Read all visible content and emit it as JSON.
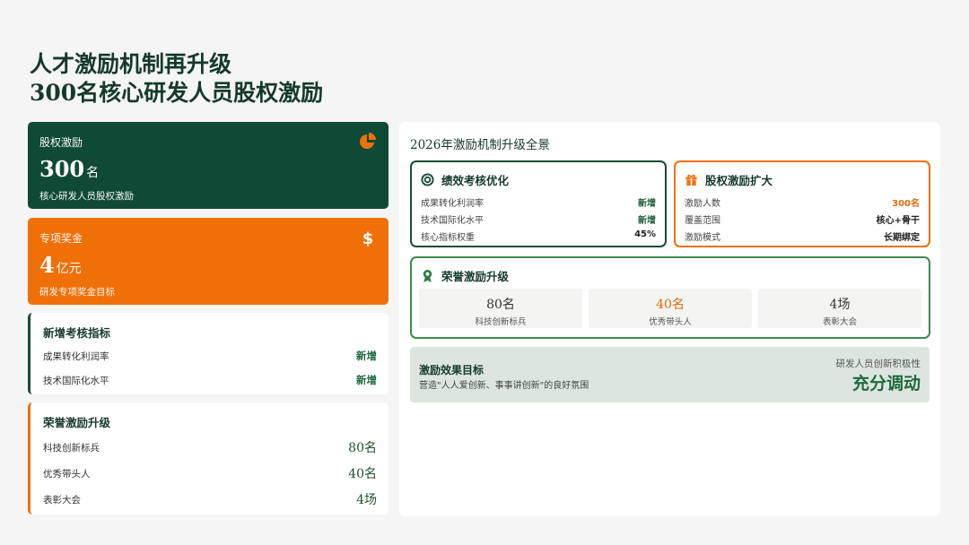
{
  "title": {
    "line1": "人才激励机制再升级",
    "line2": "300名核心研发人员股权激励"
  },
  "left": {
    "equity_card": {
      "label": "股权激励",
      "value": "300",
      "unit": "名",
      "sub": "核心研发人员股权激励",
      "icon": "pie-chart-icon",
      "bg": "#0f4a37"
    },
    "bonus_card": {
      "label": "专项奖金",
      "value": "4",
      "unit": "亿元",
      "sub": "研发专项奖金目标",
      "icon": "dollar-icon",
      "bg": "#f07008"
    },
    "new_metrics": {
      "heading": "新增考核指标",
      "rows": [
        {
          "label": "成果转化利润率",
          "value": "新增"
        },
        {
          "label": "技术国际化水平",
          "value": "新增"
        }
      ]
    },
    "honor": {
      "heading": "荣誉激励升级",
      "rows": [
        {
          "label": "科技创新标兵",
          "value": "80名"
        },
        {
          "label": "优秀带头人",
          "value": "40名"
        },
        {
          "label": "表彰大会",
          "value": "4场"
        }
      ]
    }
  },
  "panel": {
    "title": "2026年激励机制升级全景",
    "perf": {
      "heading": "绩效考核优化",
      "icon": "target-icon",
      "rows": [
        {
          "label": "成果转化利润率",
          "value": "新增"
        },
        {
          "label": "技术国际化水平",
          "value": "新增"
        },
        {
          "label": "核心指标权重",
          "value": "45%"
        }
      ]
    },
    "equity": {
      "heading": "股权激励扩大",
      "icon": "gift-icon",
      "rows": [
        {
          "label": "激励人数",
          "value": "300名"
        },
        {
          "label": "覆盖范围",
          "value": "核心+骨干"
        },
        {
          "label": "激励模式",
          "value": "长期绑定"
        }
      ]
    },
    "honor": {
      "heading": "荣誉激励升级",
      "icon": "award-icon",
      "cells": [
        {
          "value": "80名",
          "label": "科技创新标兵"
        },
        {
          "value": "40名",
          "label": "优秀带头人"
        },
        {
          "value": "4场",
          "label": "表彰大会"
        }
      ]
    },
    "goal": {
      "heading": "激励效果目标",
      "desc": "营造\"人人爱创新、事事讲创新\"的良好氛围",
      "right_label": "研发人员创新积极性",
      "right_value": "充分调动"
    }
  },
  "colors": {
    "green": "#174d36",
    "orange": "#f07008"
  }
}
